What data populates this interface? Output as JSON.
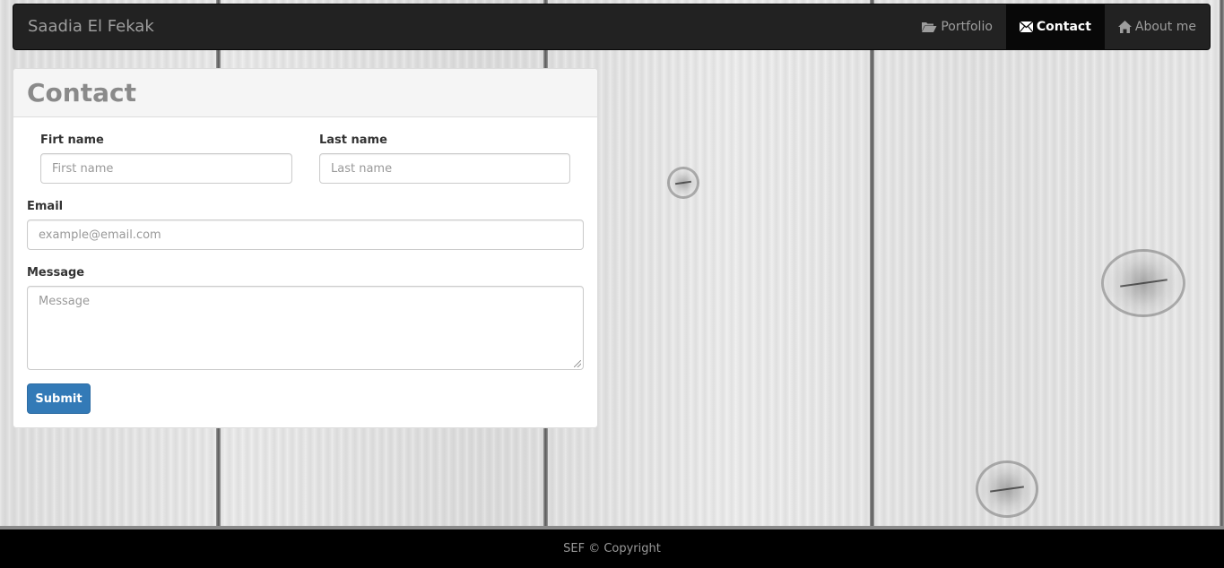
{
  "navbar": {
    "brand": "Saadia El Fekak",
    "items": [
      {
        "label": "Portfolio",
        "icon": "folder-open-icon",
        "active": false
      },
      {
        "label": "Contact",
        "icon": "envelope-icon",
        "active": true
      },
      {
        "label": "About me",
        "icon": "home-icon",
        "active": false
      }
    ]
  },
  "panel": {
    "title": "Contact",
    "first_name": {
      "label": "Firt name",
      "placeholder": "First name"
    },
    "last_name": {
      "label": "Last name",
      "placeholder": "Last name"
    },
    "email": {
      "label": "Email",
      "placeholder": "example@email.com"
    },
    "message": {
      "label": "Message",
      "placeholder": "Message"
    },
    "submit_label": "Submit"
  },
  "footer": {
    "text": "SEF © Copyright"
  },
  "colors": {
    "navbar_bg": "#222222",
    "active_nav_bg": "#080808",
    "primary_button": "#337ab7",
    "footer_bg": "#000000"
  }
}
